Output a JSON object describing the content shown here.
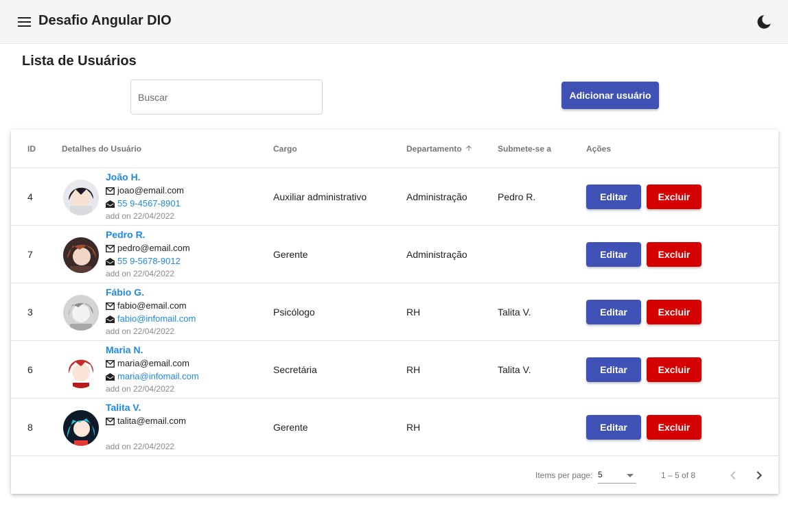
{
  "app": {
    "title": "Desafio Angular DIO"
  },
  "icons": {
    "menu": "menu-icon",
    "theme": "moon-icon",
    "email": "mail-icon",
    "phone": "phone-icon",
    "sort": "arrow-up-icon"
  },
  "colors": {
    "primary": "#3f51b5",
    "danger": "#d50000",
    "link": "#1e88e5",
    "toolbar": "#f5f5f5"
  },
  "page": {
    "title": "Lista de Usuários"
  },
  "search": {
    "placeholder": "Buscar",
    "value": ""
  },
  "add_button": "Adicionar usuário",
  "table": {
    "headers": {
      "id": "ID",
      "details": "Detalhes do Usuário",
      "role": "Cargo",
      "department": "Departamento",
      "reports_to": "Submete-se a",
      "actions": "Ações"
    },
    "sort": {
      "column": "Departamento",
      "direction": "asc"
    },
    "rows": [
      {
        "id": "4",
        "name": "João H.",
        "email": "joao@email.com",
        "contact": "55 9-4567-8901",
        "added": "add on 22/04/2022",
        "role": "Auxiliar administrativo",
        "department": "Administração",
        "reports_to": "Pedro R.",
        "edit": "Editar",
        "delete": "Excluir"
      },
      {
        "id": "7",
        "name": "Pedro R.",
        "email": "pedro@email.com",
        "contact": "55 9-5678-9012",
        "added": "add on 22/04/2022",
        "role": "Gerente",
        "department": "Administração",
        "reports_to": "",
        "edit": "Editar",
        "delete": "Excluir"
      },
      {
        "id": "3",
        "name": "Fábio G.",
        "email": "fabio@email.com",
        "contact": "fabio@infomail.com",
        "added": "add on 22/04/2022",
        "role": "Psicólogo",
        "department": "RH",
        "reports_to": "Talita V.",
        "edit": "Editar",
        "delete": "Excluir"
      },
      {
        "id": "6",
        "name": "Maria N.",
        "email": "maria@email.com",
        "contact": "maria@infomail.com",
        "added": "add on 22/04/2022",
        "role": "Secretária",
        "department": "RH",
        "reports_to": "Talita V.",
        "edit": "Editar",
        "delete": "Excluir"
      },
      {
        "id": "8",
        "name": "Talita V.",
        "email": "talita@email.com",
        "contact": "",
        "added": "add on 22/04/2022",
        "role": "Gerente",
        "department": "RH",
        "reports_to": "",
        "edit": "Editar",
        "delete": "Excluir"
      }
    ]
  },
  "paginator": {
    "label": "Items per page:",
    "page_size": "5",
    "range": "1 – 5 of 8"
  }
}
